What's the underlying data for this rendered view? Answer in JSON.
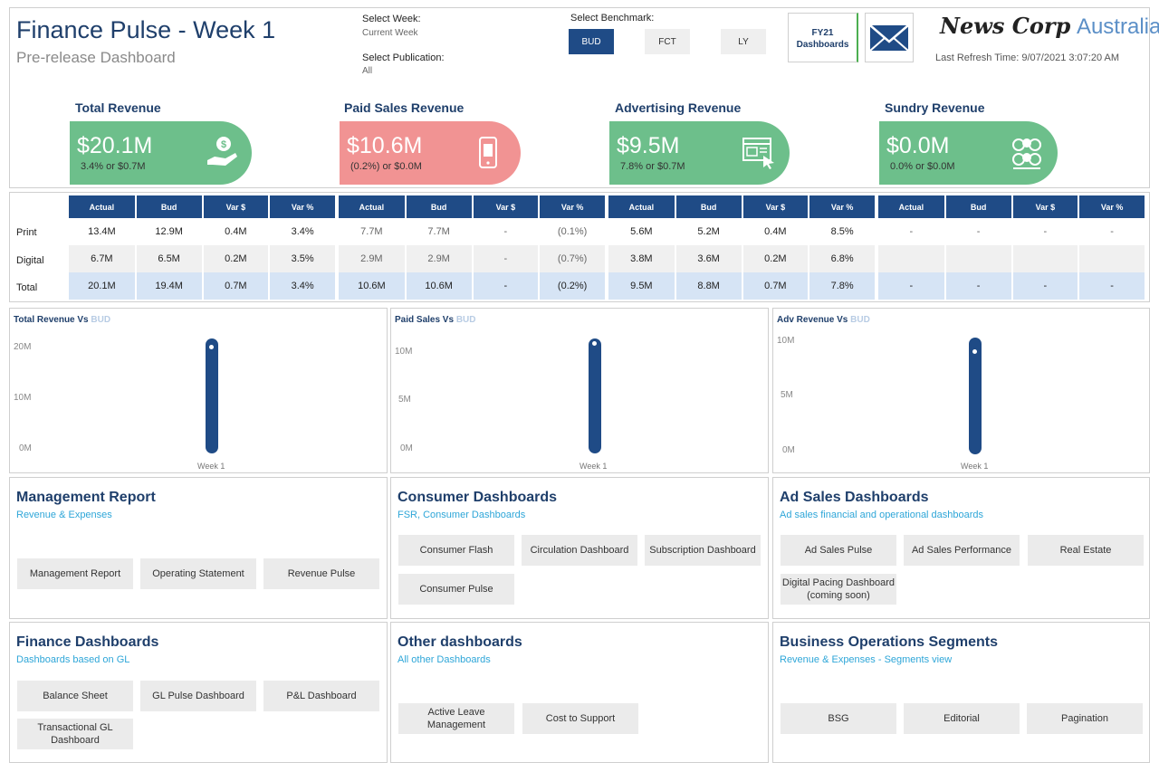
{
  "header": {
    "title": "Finance Pulse - Week 1",
    "subtitle": "Pre-release Dashboard",
    "select_week_label": "Select Week:",
    "select_week_value": "Current Week",
    "select_publication_label": "Select Publication:",
    "select_publication_value": "All",
    "select_benchmark_label": "Select Benchmark:",
    "benchmarks": [
      "BUD",
      "FCT",
      "LY"
    ],
    "selected_benchmark": "BUD",
    "fy21_button": "FY21 Dashboards",
    "logo_newscorp": "News Corp",
    "logo_australia": "Australia",
    "last_refresh": "Last Refresh Time: 9/07/2021 3:07:20 AM"
  },
  "kpis": [
    {
      "title": "Total Revenue",
      "value": "$20.1M",
      "variance": "3.4% or $0.7M",
      "color": "#6dbf8b",
      "icon": "money-hand-icon"
    },
    {
      "title": "Paid Sales Revenue",
      "value": "$10.6M",
      "variance": "(0.2%) or $0.0M",
      "color": "#f19393",
      "icon": "mobile-paid-icon"
    },
    {
      "title": "Advertising Revenue",
      "value": "$9.5M",
      "variance": "7.8% or $0.7M",
      "color": "#6dbf8b",
      "icon": "web-ad-icon"
    },
    {
      "title": "Sundry Revenue",
      "value": "$0.0M",
      "variance": "0.0% or $0.0M",
      "color": "#6dbf8b",
      "icon": "coins-icon"
    }
  ],
  "table": {
    "columns": [
      "Actual",
      "Bud",
      "Var $",
      "Var %"
    ],
    "row_labels": [
      "Print",
      "Digital",
      "Total"
    ],
    "groups": [
      {
        "rows": [
          [
            "13.4M",
            "12.9M",
            "0.4M",
            "3.4%"
          ],
          [
            "6.7M",
            "6.5M",
            "0.2M",
            "3.5%"
          ],
          [
            "20.1M",
            "19.4M",
            "0.7M",
            "3.4%"
          ]
        ]
      },
      {
        "rows": [
          [
            "7.7M",
            "7.7M",
            "-",
            "(0.1%)"
          ],
          [
            "2.9M",
            "2.9M",
            "-",
            "(0.7%)"
          ],
          [
            "10.6M",
            "10.6M",
            "-",
            "(0.2%)"
          ]
        ]
      },
      {
        "rows": [
          [
            "5.6M",
            "5.2M",
            "0.4M",
            "8.5%"
          ],
          [
            "3.8M",
            "3.6M",
            "0.2M",
            "6.8%"
          ],
          [
            "9.5M",
            "8.8M",
            "0.7M",
            "7.8%"
          ]
        ]
      },
      {
        "rows": [
          [
            "-",
            "-",
            "-",
            "-"
          ],
          [
            "",
            "",
            "",
            ""
          ],
          [
            "-",
            "-",
            "-",
            "-"
          ]
        ]
      }
    ]
  },
  "chart_data": [
    {
      "type": "bar",
      "title": "Total Revenue Vs",
      "title_highlight": "BUD",
      "categories": [
        "Week 1"
      ],
      "values": [
        20.1
      ],
      "target": [
        19.4
      ],
      "y_ticks": [
        "20M",
        "10M",
        "0M"
      ],
      "ylim": [
        0,
        20.1
      ]
    },
    {
      "type": "bar",
      "title": "Paid Sales Vs",
      "title_highlight": "BUD",
      "categories": [
        "Week 1"
      ],
      "values": [
        10.6
      ],
      "target": [
        10.6
      ],
      "y_ticks": [
        "10M",
        "5M",
        "0M"
      ],
      "ylim": [
        0,
        10.6
      ]
    },
    {
      "type": "bar",
      "title": "Adv Revenue Vs",
      "title_highlight": "BUD",
      "categories": [
        "Week 1"
      ],
      "values": [
        9.5
      ],
      "target": [
        8.8
      ],
      "y_ticks": [
        "10M",
        "5M",
        "0M"
      ],
      "ylim": [
        0,
        9.5
      ]
    }
  ],
  "sections": [
    {
      "title": "Management Report",
      "desc": "Revenue & Expenses",
      "buttons": [
        "Management Report",
        "Operating Statement",
        "Revenue Pulse"
      ]
    },
    {
      "title": "Consumer Dashboards",
      "desc": "FSR, Consumer Dashboards",
      "buttons": [
        "Consumer Flash",
        "Circulation Dashboard",
        "Subscription Dashboard",
        "Consumer Pulse"
      ]
    },
    {
      "title": "Ad Sales Dashboards",
      "desc": "Ad sales financial and operational dashboards",
      "buttons": [
        "Ad Sales Pulse",
        "Ad Sales Performance",
        "Real Estate",
        "Digital Pacing Dashboard (coming soon)"
      ]
    },
    {
      "title": "Finance Dashboards",
      "desc": "Dashboards based on GL",
      "buttons": [
        "Balance Sheet",
        "GL Pulse Dashboard",
        "P&L Dashboard",
        "Transactional GL Dashboard"
      ]
    },
    {
      "title": "Other dashboards",
      "desc": "All other Dashboards",
      "buttons": [
        "Active Leave Management",
        "Cost to Support"
      ]
    },
    {
      "title": "Business Operations Segments",
      "desc": "Revenue & Expenses - Segments view",
      "buttons": [
        "BSG",
        "Editorial",
        "Pagination"
      ]
    }
  ]
}
